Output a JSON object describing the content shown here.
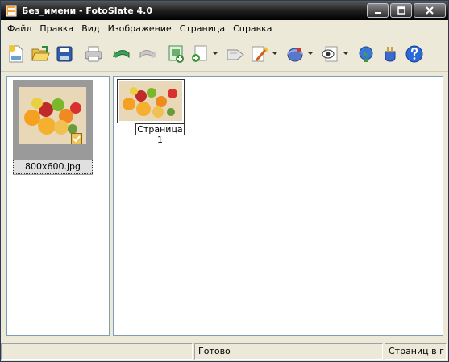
{
  "window": {
    "title": "Без_имени - FotoSlate 4.0"
  },
  "menu": {
    "items": [
      "Файл",
      "Правка",
      "Вид",
      "Изображение",
      "Страница",
      "Справка"
    ]
  },
  "toolbar": {
    "buttons": [
      "new-icon",
      "open-icon",
      "save-icon",
      "print-icon",
      "undo-icon",
      "redo-icon",
      "add-image-icon",
      "add-page-icon",
      "edit-icon",
      "effects-icon",
      "share-icon",
      "preview-icon",
      "web-icon",
      "plugin-icon",
      "help-icon"
    ]
  },
  "left_pane": {
    "thumbnail": {
      "filename": "800x600.jpg"
    }
  },
  "right_pane": {
    "page": {
      "label": "Страница 1"
    }
  },
  "status": {
    "left": "",
    "middle": "Готово",
    "right": "Страниц в г"
  },
  "colors": {
    "accent": "#7f9db9",
    "titlebar": "#1c1c1c",
    "background": "#ece9d8"
  }
}
